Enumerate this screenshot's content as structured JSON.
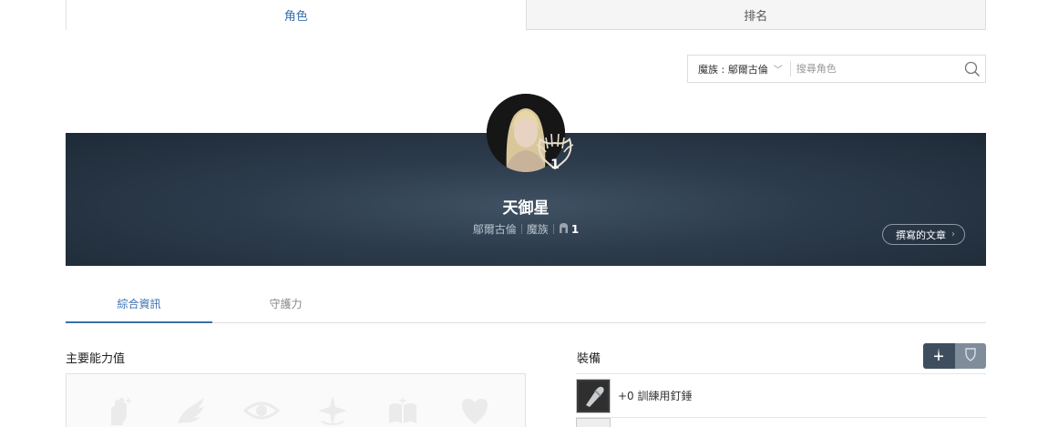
{
  "top_tabs": [
    {
      "label": "角色",
      "active": true
    },
    {
      "label": "排名",
      "active": false
    }
  ],
  "search": {
    "server_label": "魔族 : 鄔爾古倫",
    "placeholder": "搜尋角色"
  },
  "character": {
    "name": "天御星",
    "server": "鄔爾古倫",
    "race": "魔族",
    "level": "1",
    "emblem_level": "1",
    "posts_button": "撰寫的文章"
  },
  "sub_tabs": [
    {
      "label": "綜合資訊",
      "active": true
    },
    {
      "label": "守護力",
      "active": false
    }
  ],
  "stats": {
    "title": "主要能力值",
    "icons": [
      "fist-icon",
      "wing-icon",
      "eye-icon",
      "star-burst-icon",
      "book-icon",
      "heart-icon"
    ]
  },
  "equipment": {
    "title": "裝備",
    "items": [
      {
        "name": "+0 訓練用釘錘",
        "icon": "mace-icon"
      }
    ]
  },
  "colors": {
    "accent": "#3a6fb0",
    "banner": "#2c3b4b"
  }
}
